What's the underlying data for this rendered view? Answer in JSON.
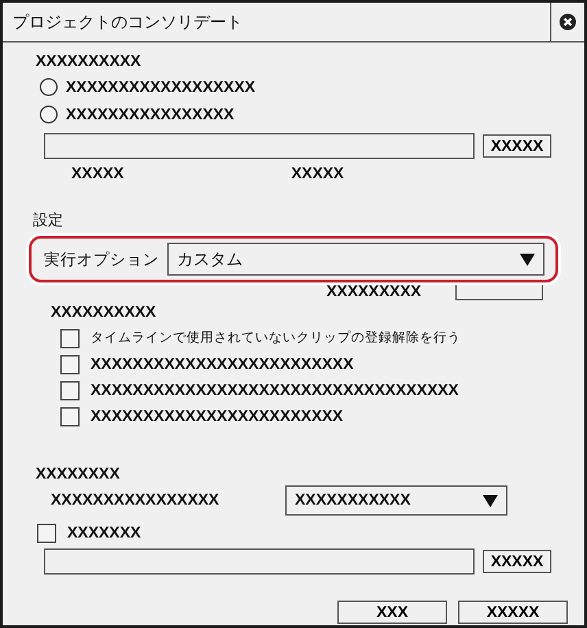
{
  "window": {
    "title": "プロジェクトのコンソリデート"
  },
  "target": {
    "heading": "XXXXXXXXXX",
    "options": [
      {
        "label": "XXXXXXXXXXXXXXXXXX",
        "selected": false
      },
      {
        "label": "XXXXXXXXXXXXXXXX",
        "selected": false
      }
    ],
    "browse_button": "XXXXX",
    "info": [
      "XXXXX",
      "XXXXX"
    ]
  },
  "settings": {
    "heading": "設定",
    "option_label": "実行オプション",
    "option_value": "カスタム",
    "highlighted": true,
    "size_label": "XXXXXXXXX",
    "group_heading": "XXXXXXXXXX",
    "checks": [
      {
        "label": "タイムラインで使用されていないクリップの登録解除を行う",
        "checked": false,
        "kind": "jp"
      },
      {
        "label": "XXXXXXXXXXXXXXXXXXXXXXXXX",
        "checked": false,
        "kind": "x"
      },
      {
        "label": "XXXXXXXXXXXXXXXXXXXXXXXXXXXXXXXXXXX",
        "checked": false,
        "kind": "x"
      },
      {
        "label": "XXXXXXXXXXXXXXXXXXXXXXXX",
        "checked": false,
        "kind": "x"
      }
    ]
  },
  "output": {
    "heading": "XXXXXXXX",
    "format_label": "XXXXXXXXXXXXXXXX",
    "format_value": "XXXXXXXXXXX",
    "check": {
      "label": "XXXXXXX",
      "checked": false
    },
    "browse_button": "XXXXX"
  },
  "buttons": [
    "XXX",
    "XXXXX"
  ]
}
